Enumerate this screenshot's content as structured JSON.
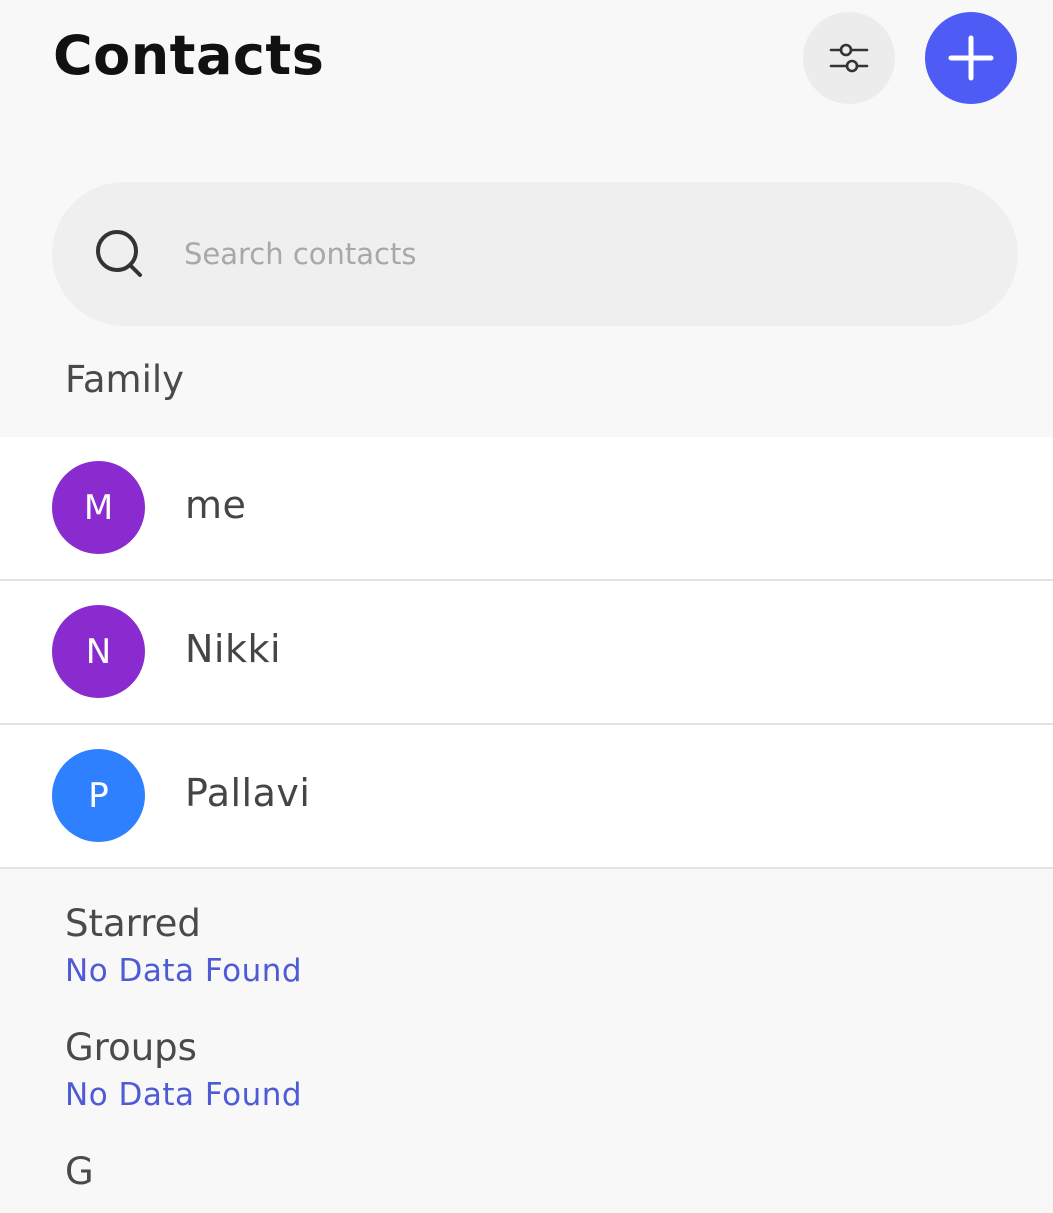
{
  "header": {
    "title": "Contacts",
    "filter_icon": "sliders-icon",
    "add_icon": "plus-icon"
  },
  "search": {
    "placeholder": "Search contacts",
    "value": "",
    "icon": "search-icon"
  },
  "sections": {
    "family": {
      "title": "Family",
      "contacts": [
        {
          "initial": "M",
          "name": "me",
          "color": "#8a2bd0"
        },
        {
          "initial": "N",
          "name": "Nikki",
          "color": "#8a2bd0"
        },
        {
          "initial": "P",
          "name": "Pallavi",
          "color": "#2f80ff"
        }
      ]
    },
    "starred": {
      "title": "Starred",
      "empty_text": "No Data Found"
    },
    "groups": {
      "title": "Groups",
      "empty_text": "No Data Found"
    },
    "alphabet": {
      "title": "G"
    }
  },
  "colors": {
    "accent": "#4f5bf5",
    "link": "#4f5bd5",
    "background": "#f8f8f8"
  }
}
